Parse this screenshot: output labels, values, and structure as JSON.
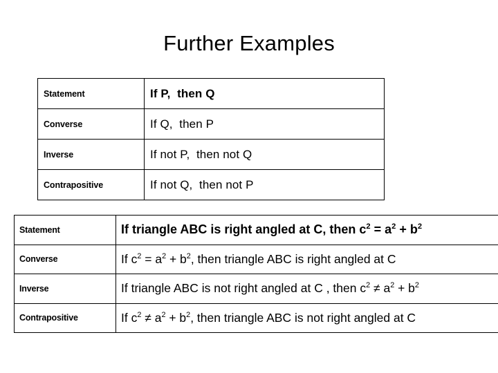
{
  "slide": {
    "title": "Further Examples"
  },
  "generic_table": {
    "name": "generic-conditional-table",
    "rows": [
      {
        "label": "Statement",
        "value": "If P,  then Q",
        "bold": true
      },
      {
        "label": "Converse",
        "value": "If Q,  then P",
        "bold": false
      },
      {
        "label": "Inverse",
        "value": "If not P,  then not Q",
        "bold": false
      },
      {
        "label": "Contrapositive",
        "value": "If not Q,  then not P",
        "bold": false
      }
    ]
  },
  "pythagoras_table": {
    "name": "pythagoras-conditional-table",
    "rows": [
      {
        "label": "Statement",
        "value_parts": [
          "If triangle ABC is right angled at C, then c",
          "2",
          " = a",
          "2",
          " + b",
          "2"
        ],
        "value_plain": "If triangle ABC is right angled at C, then c2 = a2 + b2",
        "bold": true
      },
      {
        "label": "Converse",
        "value_parts": [
          "If c",
          "2",
          " = a",
          "2",
          " + b",
          "2",
          ", then triangle ABC is right angled at C"
        ],
        "value_plain": "If c2 = a2 + b2, then triangle ABC is right angled at C",
        "bold": false
      },
      {
        "label": "Inverse",
        "value_parts": [
          "If triangle ABC is not right angled at C , then c",
          "2",
          " ≠ a",
          "2",
          " + b",
          "2"
        ],
        "value_plain": "If triangle ABC is not right angled at C , then c2 ≠ a2 + b2",
        "bold": false
      },
      {
        "label": "Contrapositive",
        "value_parts": [
          "If c",
          "2",
          " ≠ a",
          "2",
          " + b",
          "2",
          ", then triangle ABC is not right angled at C"
        ],
        "value_plain": "If c2 ≠ a2 + b2, then triangle ABC is not right angled at C",
        "bold": false
      }
    ]
  },
  "colors": {
    "background": "#ffffff",
    "text": "#000000",
    "border": "#000000"
  }
}
